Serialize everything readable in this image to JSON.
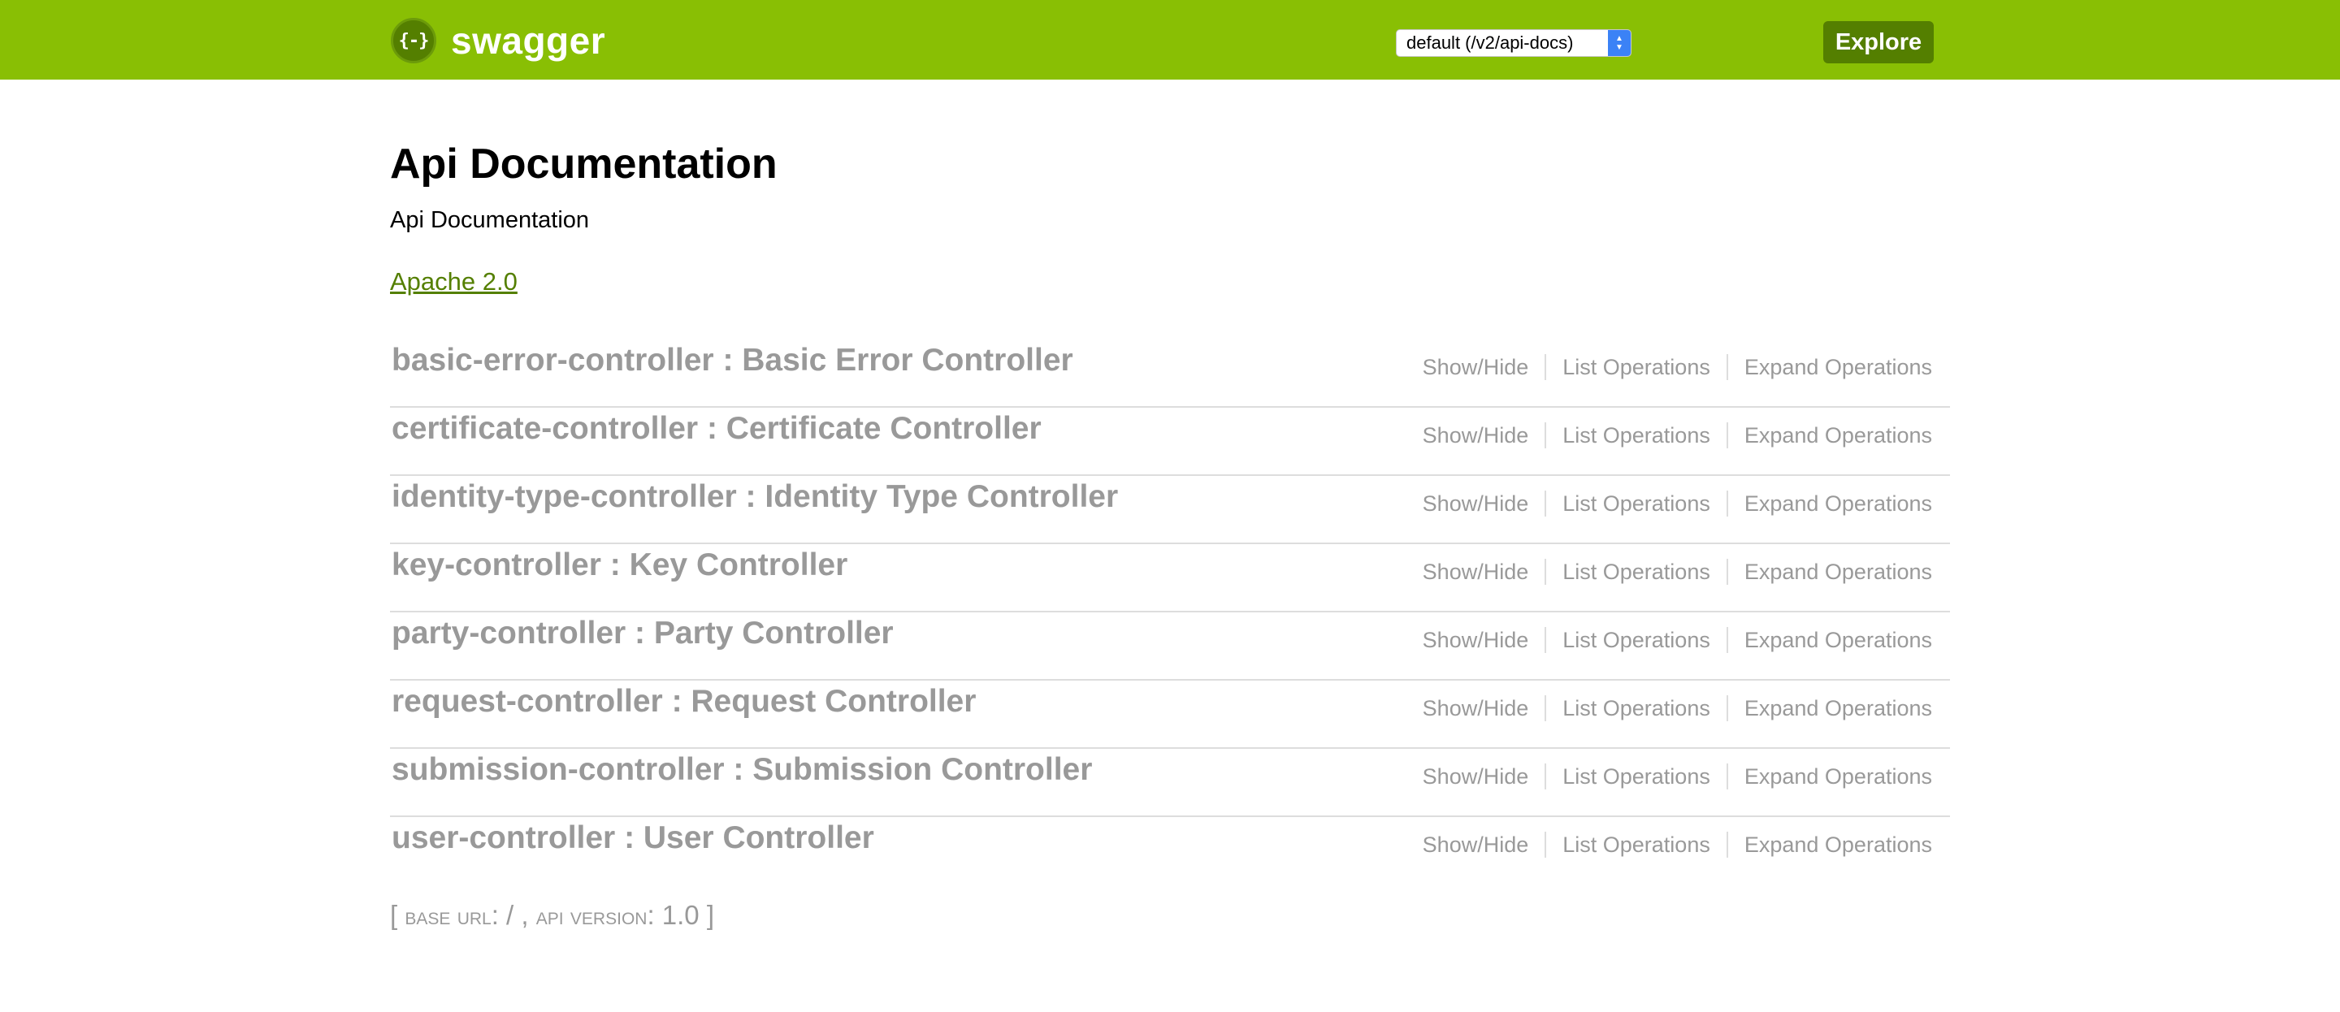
{
  "header": {
    "logo_icon_text": "{-}",
    "logo_text": "swagger",
    "spec_select": "default (/v2/api-docs)",
    "explore_label": "Explore"
  },
  "info": {
    "title": "Api Documentation",
    "description": "Api Documentation",
    "license": "Apache 2.0"
  },
  "resources": [
    {
      "name": "basic-error-controller : Basic Error Controller"
    },
    {
      "name": "certificate-controller : Certificate Controller"
    },
    {
      "name": "identity-type-controller : Identity Type Controller"
    },
    {
      "name": "key-controller : Key Controller"
    },
    {
      "name": "party-controller : Party Controller"
    },
    {
      "name": "request-controller : Request Controller"
    },
    {
      "name": "submission-controller : Submission Controller"
    },
    {
      "name": "user-controller : User Controller"
    }
  ],
  "operations": {
    "show_hide": "Show/Hide",
    "list": "List Operations",
    "expand": "Expand Operations"
  },
  "footer": {
    "open": "[",
    "base_url_label": "base url",
    "base_url_value": ": / ,",
    "api_version_label": "api version",
    "api_version_value": ": 1.0",
    "close": "]"
  },
  "colors": {
    "header_bg": "#89bf04",
    "accent_dark": "#547f00",
    "resource_text": "#999999",
    "divider": "#dddddd"
  }
}
